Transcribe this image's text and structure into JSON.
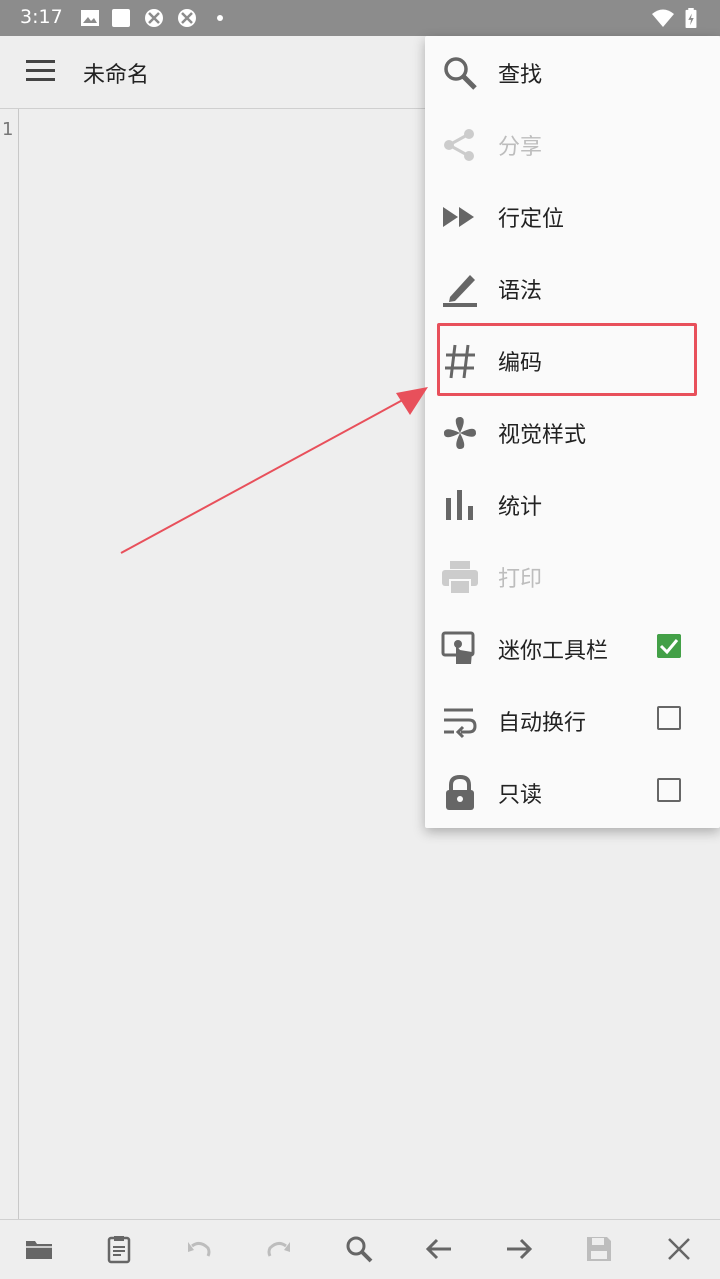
{
  "status_bar": {
    "time": "3:17"
  },
  "app_bar": {
    "title": "未命名"
  },
  "editor": {
    "line_number": "1"
  },
  "menu": {
    "items": [
      {
        "label": "查找",
        "icon": "search-icon",
        "enabled": true
      },
      {
        "label": "分享",
        "icon": "share-icon",
        "enabled": false
      },
      {
        "label": "行定位",
        "icon": "fast-forward-icon",
        "enabled": true
      },
      {
        "label": "语法",
        "icon": "highlighter-icon",
        "enabled": true
      },
      {
        "label": "编码",
        "icon": "hash-icon",
        "enabled": true
      },
      {
        "label": "视觉样式",
        "icon": "pinwheel-icon",
        "enabled": true
      },
      {
        "label": "统计",
        "icon": "bar-chart-icon",
        "enabled": true
      },
      {
        "label": "打印",
        "icon": "printer-icon",
        "enabled": false
      },
      {
        "label": "迷你工具栏",
        "icon": "touch-icon",
        "enabled": true,
        "checked": true
      },
      {
        "label": "自动换行",
        "icon": "wrap-text-icon",
        "enabled": true,
        "checked": false
      },
      {
        "label": "只读",
        "icon": "lock-icon",
        "enabled": true,
        "checked": false
      }
    ]
  },
  "bottom_toolbar": {
    "buttons": [
      "folder-icon",
      "clipboard-icon",
      "undo-icon",
      "redo-icon",
      "search-icon",
      "arrow-left-icon",
      "arrow-right-icon",
      "save-icon",
      "close-icon"
    ]
  },
  "colors": {
    "highlight_border": "#e8505b",
    "checkbox_checked": "#43a047",
    "icon_gray": "#666666"
  }
}
